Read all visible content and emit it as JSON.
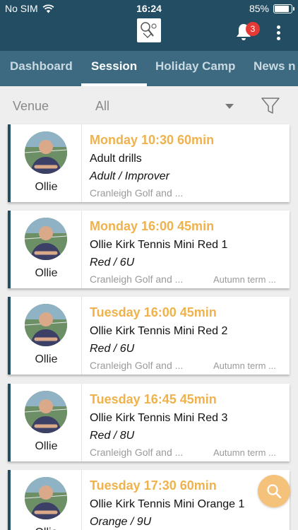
{
  "status_bar": {
    "carrier": "No SIM",
    "time": "16:24",
    "battery": "85%",
    "battery_level": 0.85
  },
  "header": {
    "notification_count": "3",
    "colors": {
      "header_bg": "#234d63",
      "tabs_bg": "#3d6a80",
      "accent": "#efb24c",
      "badge": "#e53935"
    }
  },
  "tabs": [
    {
      "label": "Dashboard",
      "active": false
    },
    {
      "label": "Session",
      "active": true
    },
    {
      "label": "Holiday Camp",
      "active": false
    },
    {
      "label": "News n",
      "active": false
    }
  ],
  "filter": {
    "venue_label": "Venue",
    "venue_value": "All"
  },
  "sessions": [
    {
      "coach": "Ollie",
      "time": "Monday 10:30 60min",
      "title": "Adult drills",
      "level": "Adult / Improver",
      "venue": "Cranleigh Golf and ...",
      "term": ""
    },
    {
      "coach": "Ollie",
      "time": "Monday 16:00 45min",
      "title": "Ollie Kirk Tennis Mini Red 1",
      "level": "Red / 6U",
      "venue": "Cranleigh Golf and ...",
      "term": "Autumn term ..."
    },
    {
      "coach": "Ollie",
      "time": "Tuesday 16:00 45min",
      "title": "Ollie Kirk Tennis Mini Red 2",
      "level": "Red / 6U",
      "venue": "Cranleigh Golf and ...",
      "term": "Autumn term ..."
    },
    {
      "coach": "Ollie",
      "time": "Tuesday 16:45 45min",
      "title": "Ollie Kirk Tennis Mini Red 3",
      "level": "Red / 8U",
      "venue": "Cranleigh Golf and ...",
      "term": "Autumn term ..."
    },
    {
      "coach": "Ollie",
      "time": "Tuesday 17:30 60min",
      "title": "Ollie Kirk Tennis Mini Orange 1",
      "level": "Orange / 9U",
      "venue": "",
      "term": ""
    }
  ]
}
